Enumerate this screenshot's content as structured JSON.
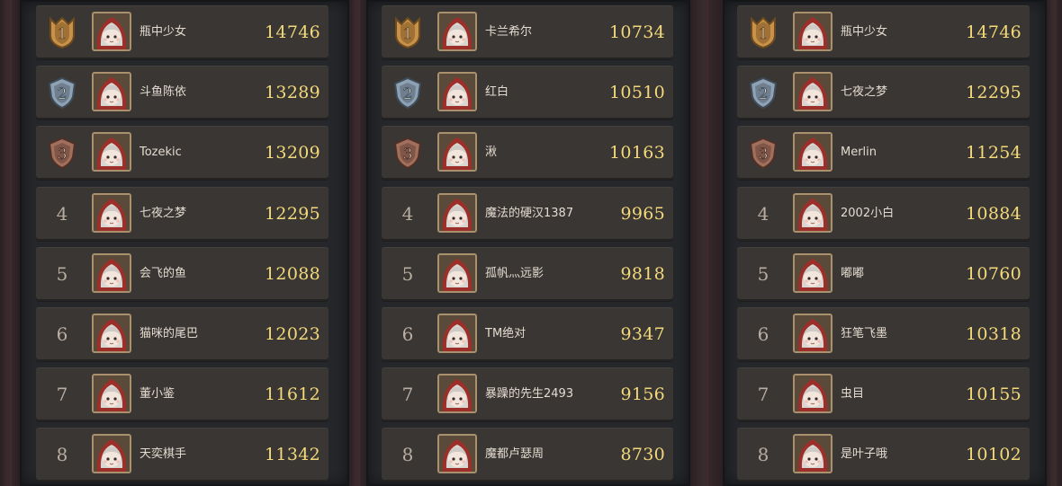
{
  "leaderboards": [
    {
      "entries": [
        {
          "rank": "1",
          "name": "瓶中少女",
          "score": "14746"
        },
        {
          "rank": "2",
          "name": "斗鱼陈依",
          "score": "13289"
        },
        {
          "rank": "3",
          "name": "Tozekic",
          "score": "13209"
        },
        {
          "rank": "4",
          "name": "七夜之梦",
          "score": "12295"
        },
        {
          "rank": "5",
          "name": "会飞的鱼",
          "score": "12088"
        },
        {
          "rank": "6",
          "name": "猫咪的尾巴",
          "score": "12023"
        },
        {
          "rank": "7",
          "name": "董小鉴",
          "score": "11612"
        },
        {
          "rank": "8",
          "name": "天奕棋手",
          "score": "11342"
        }
      ]
    },
    {
      "entries": [
        {
          "rank": "1",
          "name": "卡兰希尔",
          "score": "10734"
        },
        {
          "rank": "2",
          "name": "红白",
          "score": "10510"
        },
        {
          "rank": "3",
          "name": "湫",
          "score": "10163"
        },
        {
          "rank": "4",
          "name": "魔法的硬汉1387",
          "score": "9965"
        },
        {
          "rank": "5",
          "name": "孤帆灬远影",
          "score": "9818"
        },
        {
          "rank": "6",
          "name": "TM绝对",
          "score": "9347"
        },
        {
          "rank": "7",
          "name": "暴躁的先生2493",
          "score": "9156"
        },
        {
          "rank": "8",
          "name": "魔都卢瑟周",
          "score": "8730"
        }
      ]
    },
    {
      "entries": [
        {
          "rank": "1",
          "name": "瓶中少女",
          "score": "14746"
        },
        {
          "rank": "2",
          "name": "七夜之梦",
          "score": "12295"
        },
        {
          "rank": "3",
          "name": "Merlin",
          "score": "11254"
        },
        {
          "rank": "4",
          "name": "2002小白",
          "score": "10884"
        },
        {
          "rank": "5",
          "name": "嘟嘟",
          "score": "10760"
        },
        {
          "rank": "6",
          "name": "狂笔飞墨",
          "score": "10318"
        },
        {
          "rank": "7",
          "name": "虫目",
          "score": "10155"
        },
        {
          "rank": "8",
          "name": "是叶子哦",
          "score": "10102"
        }
      ]
    }
  ],
  "colors": {
    "gold": "#c9924a",
    "silver": "#8fa2b3",
    "bronze": "#a0705c",
    "score": "#f3d97a",
    "row": "#3a3634"
  },
  "icons": {
    "rank1": "gold-crown-medal-icon",
    "rank2": "silver-medal-icon",
    "rank3": "bronze-medal-icon",
    "avatar": "red-hooded-girl-avatar-icon"
  }
}
